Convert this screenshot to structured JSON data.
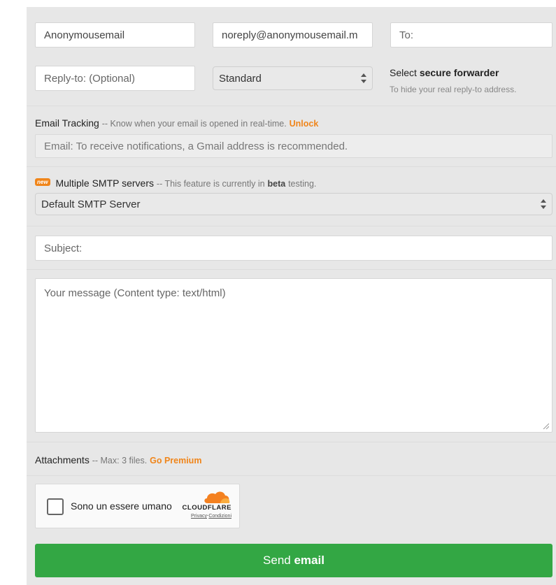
{
  "sender": {
    "name_value": "Anonymousemail",
    "from_value": "noreply@anonymousemail.m",
    "to_placeholder": "To:"
  },
  "reply": {
    "replyto_placeholder": "Reply-to: (Optional)",
    "forwarder_selected": "Standard",
    "forwarder_title_prefix": "Select",
    "forwarder_title_bold": "secure forwarder",
    "forwarder_hint": "To hide your real reply-to address."
  },
  "tracking": {
    "label": "Email Tracking",
    "note": "-- Know when your email is opened in real-time.",
    "unlock": "Unlock",
    "email_placeholder": "Email: To receive notifications, a Gmail address is recommended."
  },
  "smtp": {
    "badge": "new",
    "label": "Multiple SMTP servers",
    "note_prefix": "-- This feature is currently in",
    "note_bold": "beta",
    "note_suffix": "testing.",
    "selected": "Default SMTP Server"
  },
  "subject": {
    "placeholder": "Subject:"
  },
  "message": {
    "placeholder": "Your message (Content type: text/html)"
  },
  "attachments": {
    "label": "Attachments",
    "note": "-- Max: 3 files.",
    "premium": "Go Premium"
  },
  "captcha": {
    "label": "Sono un essere umano",
    "brand": "CLOUDFLARE",
    "privacy": "Privacy",
    "separator": "·",
    "terms": "Condizioni"
  },
  "send": {
    "prefix": "Send",
    "bold": "email"
  },
  "colors": {
    "accent": "#f0851a",
    "send": "#33a744",
    "panel": "#e7e7e7"
  }
}
